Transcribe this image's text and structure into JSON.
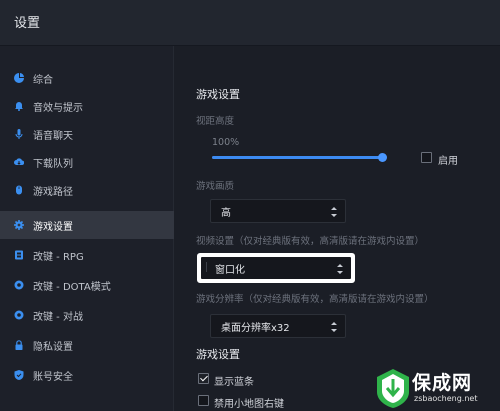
{
  "window": {
    "title": "设置"
  },
  "sidebar": {
    "items": [
      {
        "label": "综合",
        "icon": "pie-chart-icon"
      },
      {
        "label": "音效与提示",
        "icon": "bell-icon"
      },
      {
        "label": "语音聊天",
        "icon": "microphone-icon"
      },
      {
        "label": "下载队列",
        "icon": "cloud-download-icon"
      },
      {
        "label": "游戏路径",
        "icon": "mouse-icon"
      },
      {
        "label": "游戏设置",
        "icon": "gear-icon",
        "active": true
      },
      {
        "label": "改键 - RPG",
        "icon": "keymap-icon"
      },
      {
        "label": "改键 - DOTA模式",
        "icon": "keymap-icon"
      },
      {
        "label": "改键 - 对战",
        "icon": "keymap-icon"
      },
      {
        "label": "隐私设置",
        "icon": "lock-icon"
      },
      {
        "label": "账号安全",
        "icon": "shield-icon"
      }
    ]
  },
  "main": {
    "section1_title": "游戏设置",
    "view_height": {
      "label": "视距高度",
      "value_text": "100%",
      "fraction": 1.0
    },
    "enable_label": "启用",
    "quality": {
      "label": "游戏画质",
      "value": "高"
    },
    "video": {
      "label": "视频设置（仅对经典版有效，高清版请在游戏内设置）",
      "value": "窗口化"
    },
    "resolution": {
      "label": "游戏分辨率（仅对经典版有效，高清版请在游戏内设置）",
      "value": "桌面分辨率x32"
    },
    "section2_title": "游戏设置",
    "show_blue_bar": {
      "label": "显示蓝条",
      "checked": true
    },
    "disable_minimap_rightclick": {
      "label": "禁用小地图右键",
      "checked": false
    }
  },
  "watermark": {
    "text": "保成网",
    "url": "zsbaocheng.net"
  },
  "colors": {
    "accent": "#3d8bf2",
    "background": "#1b1e26",
    "sidebar_active": "#333741",
    "watermark_green": "#2fb34a"
  }
}
